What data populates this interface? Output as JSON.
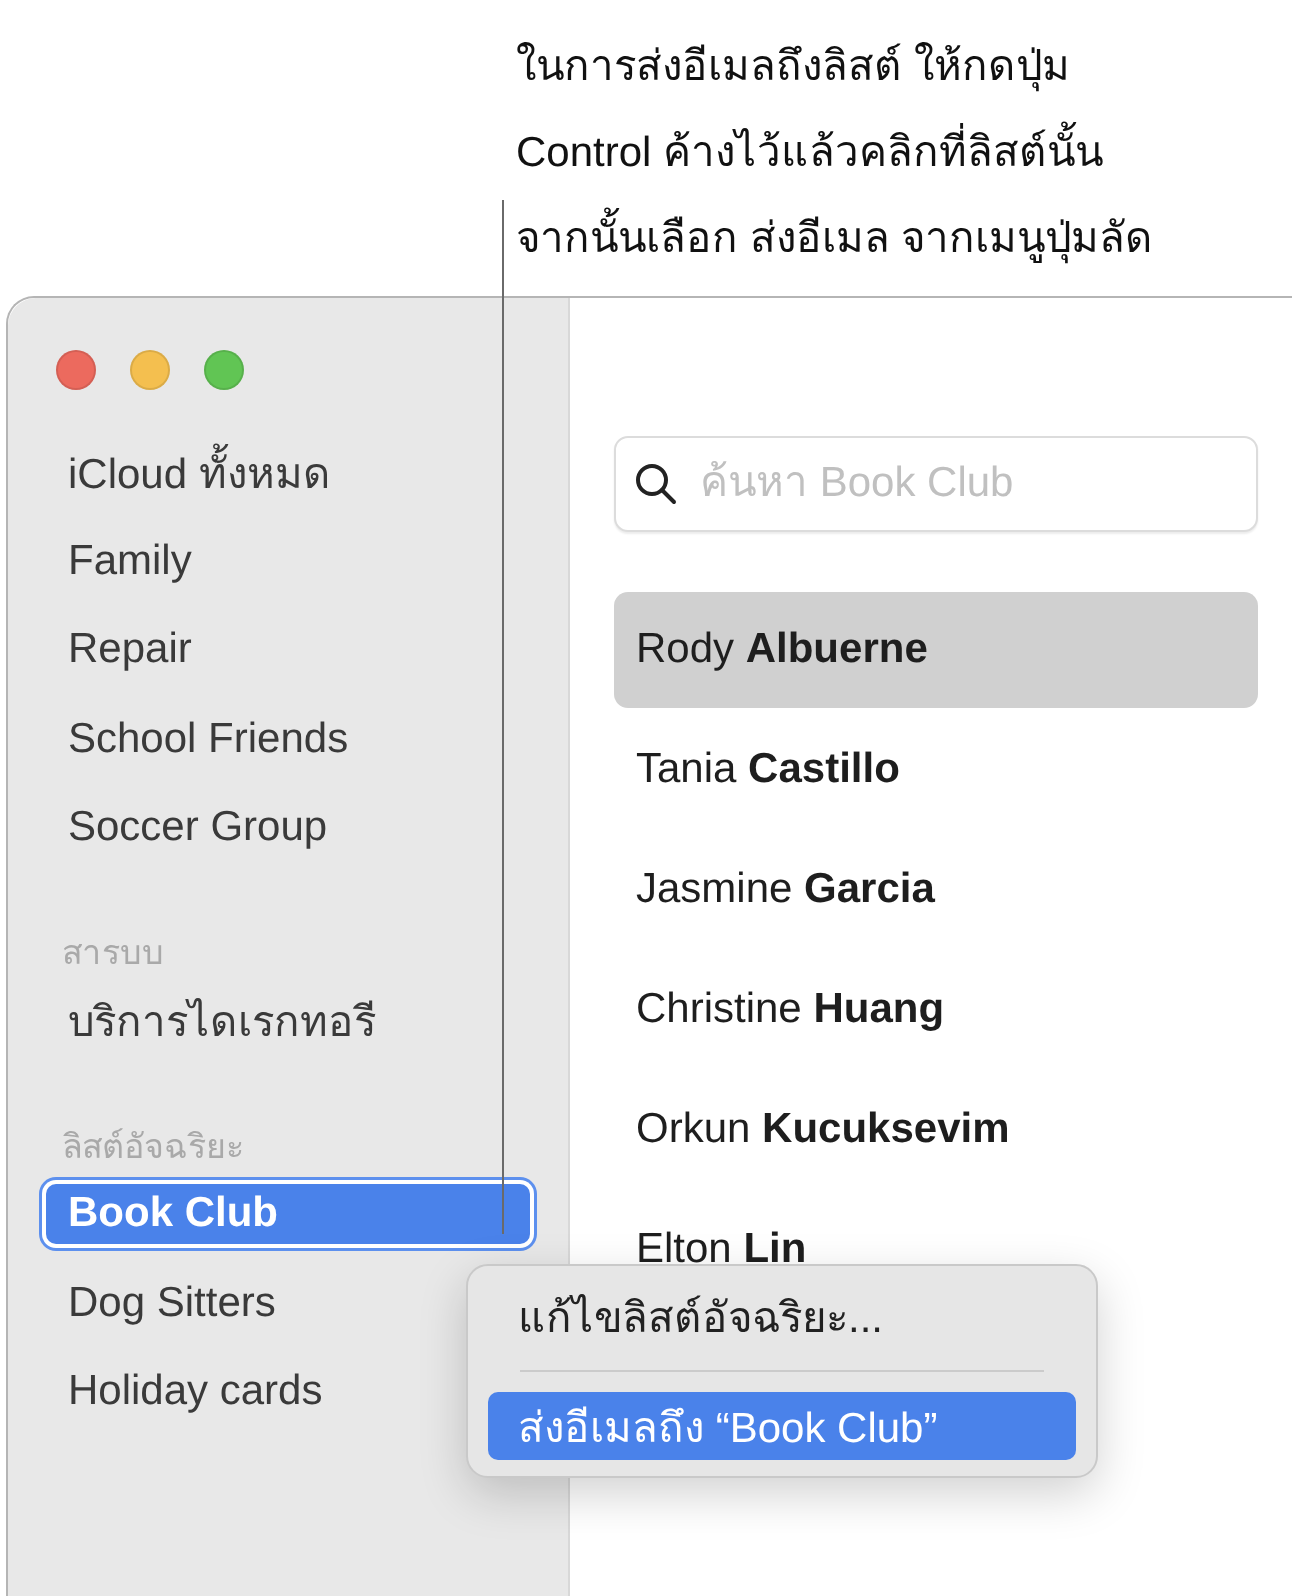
{
  "callout": {
    "text": "ในการส่งอีเมลถึงลิสต์ ให้กดปุ่ม\nControl ค้างไว้แล้วคลิกที่ลิสต์นั้น\nจากนั้นเลือก ส่งอีเมล จากเมนูปุ่มลัด"
  },
  "sidebar": {
    "items": [
      {
        "kind": "item",
        "label": "iCloud ทั้งหมด",
        "selected": false
      },
      {
        "kind": "item",
        "label": "Family",
        "selected": false
      },
      {
        "kind": "item",
        "label": "Repair",
        "selected": false
      },
      {
        "kind": "item",
        "label": "School Friends",
        "selected": false
      },
      {
        "kind": "item",
        "label": "Soccer Group",
        "selected": false
      },
      {
        "kind": "header",
        "label": "สารบบ"
      },
      {
        "kind": "item",
        "label": "บริการไดเรกทอรี",
        "selected": false
      },
      {
        "kind": "header",
        "label": "ลิสต์อัจฉริยะ"
      },
      {
        "kind": "item",
        "label": "Book Club",
        "selected": true
      },
      {
        "kind": "item",
        "label": "Dog Sitters",
        "selected": false
      },
      {
        "kind": "item",
        "label": "Holiday cards",
        "selected": false
      }
    ]
  },
  "search": {
    "placeholder": "ค้นหา Book Club"
  },
  "contacts": [
    {
      "name": "Rody **Albuerne**",
      "selected": true
    },
    {
      "name": "Tania **Castillo**",
      "selected": false
    },
    {
      "name": "Jasmine **Garcia**",
      "selected": false
    },
    {
      "name": "Christine **Huang**",
      "selected": false
    },
    {
      "name": "Orkun **Kucuksevim**",
      "selected": false
    },
    {
      "name": "Elton **Lin**",
      "selected": false
    }
  ],
  "context_menu": {
    "items": [
      {
        "kind": "item",
        "label": "แก้ไขลิสต์อัจฉริยะ...",
        "selected": false
      },
      {
        "kind": "separator"
      },
      {
        "kind": "item",
        "label": "ส่งอีเมลถึง “Book Club”",
        "selected": true
      }
    ]
  }
}
